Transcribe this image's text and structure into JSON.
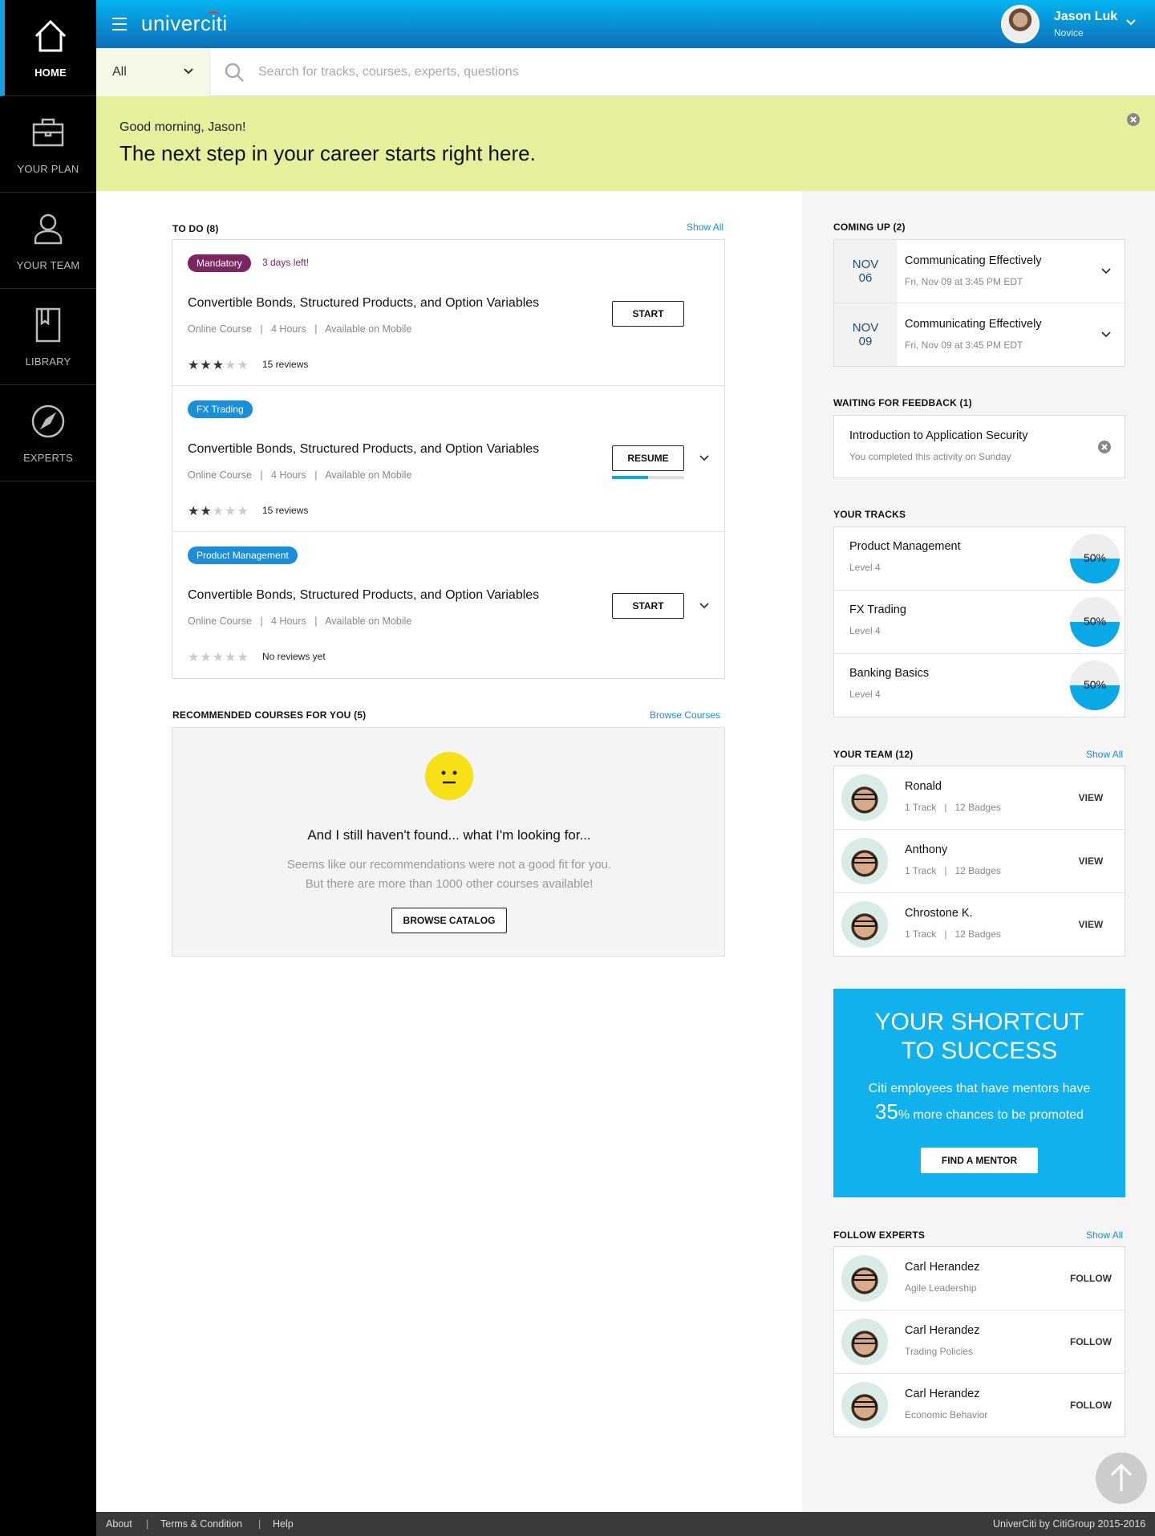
{
  "nav": {
    "items": [
      {
        "label": "HOME",
        "icon": "home-icon"
      },
      {
        "label": "YOUR PLAN",
        "icon": "briefcase-icon"
      },
      {
        "label": "YOUR TEAM",
        "icon": "person-icon"
      },
      {
        "label": "LIBRARY",
        "icon": "book-icon"
      },
      {
        "label": "EXPERTS",
        "icon": "compass-icon"
      }
    ]
  },
  "header": {
    "logo": "univerciti",
    "user_name": "Jason Luk",
    "user_role": "Novice"
  },
  "search": {
    "filter_value": "All",
    "placeholder": "Search for tracks, courses, experts, questions"
  },
  "banner": {
    "greeting": "Good morning, Jason!",
    "tagline": "The next step in your career starts right here."
  },
  "todo": {
    "heading": "TO DO (8)",
    "show_all": "Show All",
    "items": [
      {
        "tag": "Mandatory",
        "tag_color": "#7d2462",
        "days_left": "3 days left!",
        "title": "Convertible Bonds, Structured Products, and Option Variables",
        "type": "Online Course",
        "hours": "4 Hours",
        "mobile": "Available on Mobile",
        "rating": 3,
        "reviews": "15 reviews",
        "action": "START"
      },
      {
        "tag": "FX Trading",
        "tag_color": "#1a8ed8",
        "title": "Convertible Bonds, Structured Products, and Option Variables",
        "type": "Online Course",
        "hours": "4 Hours",
        "mobile": "Available on Mobile",
        "rating": 2,
        "reviews": "15 reviews",
        "action": "RESUME",
        "progress": 0.5
      },
      {
        "tag": "Product Management",
        "tag_color": "#1a8ed8",
        "title": "Convertible Bonds, Structured Products, and Option Variables",
        "type": "Online Course",
        "hours": "4 Hours",
        "mobile": "Available on Mobile",
        "rating": 0,
        "reviews": "No reviews yet",
        "action": "START"
      }
    ]
  },
  "recommended": {
    "heading": "RECOMMENDED COURSES FOR YOU (5)",
    "browse": "Browse Courses",
    "empty_title": "And I still haven't found... what I'm looking for...",
    "empty_line1": "Seems like our recommendations were not a good fit for you.",
    "empty_line2": "But there are more than 1000 other courses available!",
    "button": "BROWSE CATALOG"
  },
  "coming_up": {
    "heading": "COMING UP (2)",
    "items": [
      {
        "month": "NOV",
        "day": "06",
        "title": "Communicating Effectively",
        "when": "Fri, Nov 09 at 3:45 PM EDT"
      },
      {
        "month": "NOV",
        "day": "09",
        "title": "Communicating Effectively",
        "when": "Fri, Nov 09 at 3:45 PM EDT"
      }
    ]
  },
  "feedback": {
    "heading": "WAITING FOR FEEDBACK (1)",
    "title": "Introduction to Application Security",
    "sub": "You completed this activity on Sunday"
  },
  "tracks": {
    "heading": "YOUR TRACKS",
    "items": [
      {
        "name": "Product Management",
        "level": "Level 4",
        "pct": "50%",
        "value": 0.5
      },
      {
        "name": "FX Trading",
        "level": "Level 4",
        "pct": "50%",
        "value": 0.5
      },
      {
        "name": "Banking Basics",
        "level": "Level 4",
        "pct": "50%",
        "value": 0.5
      }
    ]
  },
  "team": {
    "heading": "YOUR TEAM (12)",
    "show_all": "Show All",
    "items": [
      {
        "name": "Ronald",
        "track": "1 Track",
        "badges": "12 Badges",
        "action": "VIEW"
      },
      {
        "name": "Anthony",
        "track": "1 Track",
        "badges": "12 Badges",
        "action": "VIEW"
      },
      {
        "name": "Chrostone K.",
        "track": "1 Track",
        "badges": "12 Badges",
        "action": "VIEW"
      }
    ]
  },
  "promo": {
    "line1": "YOUR SHORTCUT",
    "line2": "TO SUCCESS",
    "text1": "Citi employees that have mentors have",
    "big": "35",
    "text2": "% more chances to be promoted",
    "button": "FIND A MENTOR"
  },
  "experts": {
    "heading": "FOLLOW EXPERTS",
    "show_all": "Show All",
    "items": [
      {
        "name": "Carl Herandez",
        "topic": "Agile Leadership",
        "action": "FOLLOW"
      },
      {
        "name": "Carl Herandez",
        "topic": "Trading Policies",
        "action": "FOLLOW"
      },
      {
        "name": "Carl Herandez",
        "topic": "Economic Behavior",
        "action": "FOLLOW"
      }
    ]
  },
  "footer": {
    "about": "About",
    "terms": "Terms & Condition",
    "help": "Help",
    "copyright": "UniverCiti by CitiGroup 2015-2016"
  },
  "colors": {
    "accent": "#0aa8e6",
    "banner": "#e6ef9c",
    "mandatory": "#7d2462"
  }
}
